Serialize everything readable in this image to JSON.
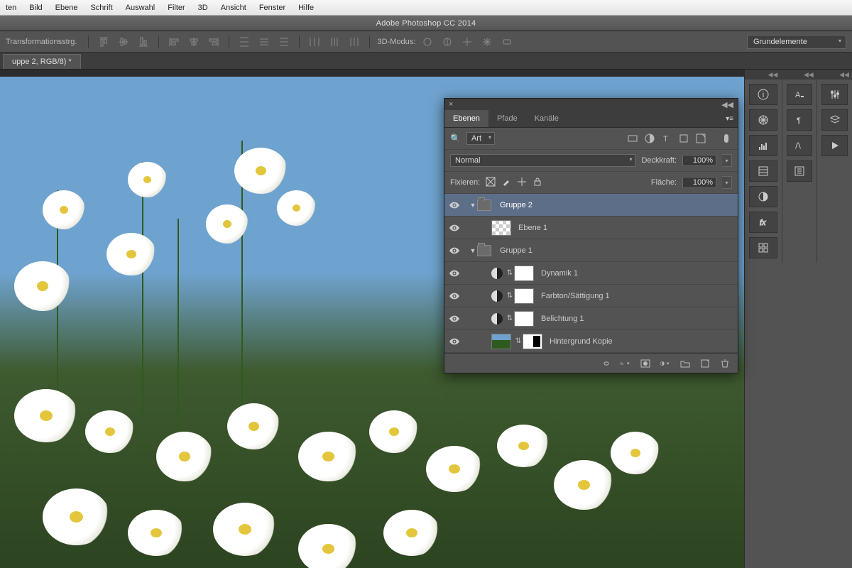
{
  "menubar": [
    "ten",
    "Bild",
    "Ebene",
    "Schrift",
    "Auswahl",
    "Filter",
    "3D",
    "Ansicht",
    "Fenster",
    "Hilfe"
  ],
  "app_title": "Adobe Photoshop CC 2014",
  "options": {
    "label": "Transformationsstrg.",
    "mode_label": "3D-Modus:",
    "workspace": "Grundelemente"
  },
  "document_tab": "uppe 2, RGB/8) *",
  "layers_panel": {
    "tabs": [
      "Ebenen",
      "Pfade",
      "Kanäle"
    ],
    "active_tab": 0,
    "filter_label": "Art",
    "blend_mode": "Normal",
    "opacity_label": "Deckkraft:",
    "opacity_value": "100%",
    "lock_label": "Fixieren:",
    "fill_label": "Fläche:",
    "fill_value": "100%",
    "layers": [
      {
        "type": "group",
        "name": "Gruppe 2",
        "depth": 0,
        "open": true,
        "selected": true,
        "eye": true
      },
      {
        "type": "layer",
        "name": "Ebene 1",
        "depth": 1,
        "thumb": "checker",
        "eye": true
      },
      {
        "type": "group",
        "name": "Gruppe 1",
        "depth": 0,
        "open": true,
        "eye": true
      },
      {
        "type": "adjustment",
        "name": "Dynamik 1",
        "depth": 1,
        "eye": true
      },
      {
        "type": "adjustment",
        "name": "Farbton/Sättigung 1",
        "depth": 1,
        "eye": true
      },
      {
        "type": "adjustment",
        "name": "Belichtung 1",
        "depth": 1,
        "eye": true
      },
      {
        "type": "layer",
        "name": "Hintergrund Kopie",
        "depth": 1,
        "thumb": "img",
        "mask": true,
        "eye": true
      }
    ]
  }
}
